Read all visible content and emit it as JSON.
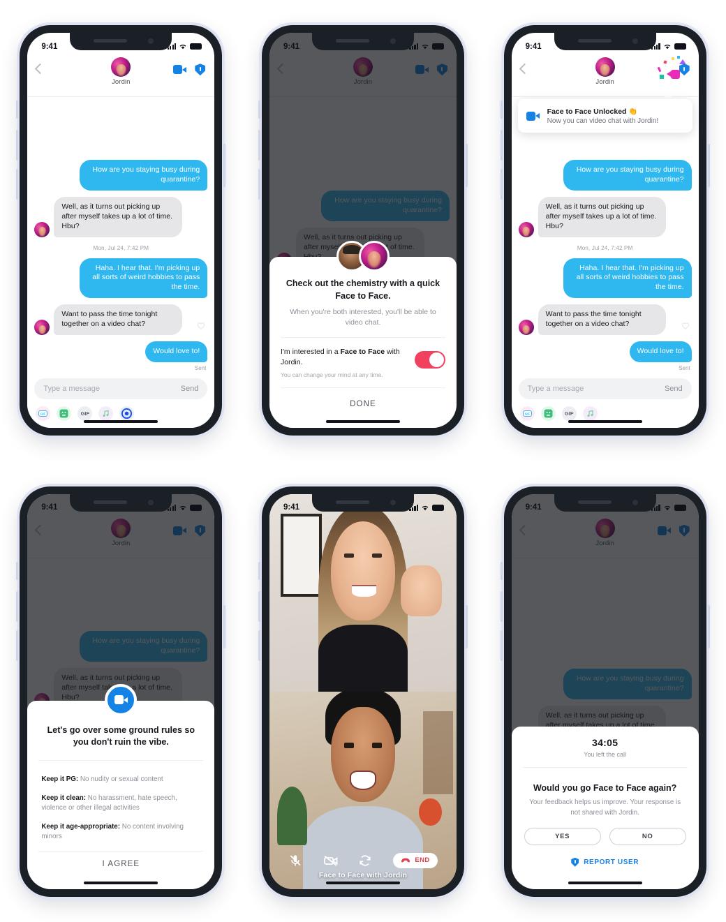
{
  "status_bar": {
    "time": "9:41",
    "signal_icon": "cellular-bars-icon",
    "wifi_icon": "wifi-icon",
    "battery_icon": "battery-icon"
  },
  "chat": {
    "contact_name": "Jordin",
    "back_icon": "back-chevron-icon",
    "video_icon": "video-camera-icon",
    "shield_icon": "shield-icon",
    "messages": [
      {
        "side": "out",
        "text": "How are you staying busy during quarantine?"
      },
      {
        "side": "in",
        "text": "Well, as it turns out picking up after myself takes up a lot of time. Hbu?"
      },
      {
        "side": "out",
        "text": "Haha. I hear that. I'm picking up all sorts of weird hobbies to pass the time."
      },
      {
        "side": "in",
        "text": "Want to pass the time tonight together on a video chat?"
      },
      {
        "side": "out",
        "text": "Would love to!"
      }
    ],
    "timestamp": "Mon, Jul 24, 7:42 PM",
    "sent_label": "Sent",
    "composer": {
      "placeholder": "Type a message",
      "send_label": "Send"
    },
    "tray": [
      {
        "name": "gif-sticker-icon",
        "label": "GIF"
      },
      {
        "name": "sticker-icon",
        "label": ""
      },
      {
        "name": "gif-icon",
        "label": "GIF"
      },
      {
        "name": "music-icon",
        "label": ""
      },
      {
        "name": "spotify-icon",
        "label": ""
      }
    ]
  },
  "toast": {
    "icon": "video-camera-icon",
    "title": "Face to Face Unlocked 👏",
    "subtitle": "Now you can video chat with Jordin!"
  },
  "interest_sheet": {
    "title": "Check out the chemistry with a quick Face to Face.",
    "subtitle": "When you're both interested, you'll be able to video chat.",
    "toggle_label_pre": "I'm interested in a ",
    "toggle_label_bold": "Face to Face",
    "toggle_label_post": " with Jordin.",
    "toggle_note": "You can change your mind at any time.",
    "toggle_state": "on",
    "toggle_color": "#f2405f",
    "cta": "DONE"
  },
  "rules_sheet": {
    "badge_icon": "video-camera-icon",
    "title": "Let's go over some ground rules so you don't ruin the vibe.",
    "rules": [
      {
        "bold": "Keep it PG:",
        "text": " No nudity or sexual content"
      },
      {
        "bold": "Keep it clean:",
        "text": " No harassment, hate speech, violence or other illegal activities"
      },
      {
        "bold": "Keep it age-appropriate:",
        "text": " No content involving minors"
      }
    ],
    "cta": "I AGREE"
  },
  "call_screen": {
    "mute_icon": "microphone-off-icon",
    "camera_off_icon": "video-off-icon",
    "flip_icon": "camera-flip-icon",
    "end_label": "END",
    "end_icon": "phone-hangup-icon",
    "end_color": "#e23b4e",
    "title": "Face to Face with Jordin"
  },
  "feedback_sheet": {
    "duration": "34:05",
    "status": "You left the call",
    "question": "Would you go Face to Face again?",
    "description": "Your feedback helps us improve. Your response is not shared with Jordin.",
    "yes_label": "YES",
    "no_label": "NO",
    "report_label": "REPORT USER",
    "report_icon": "shield-icon",
    "link_color": "#1583e5"
  },
  "theme": {
    "bubble_out": "#2fb8f0",
    "bubble_in": "#e6e6e8",
    "accent_blue": "#1583e5",
    "accent_magenta": "#e82bb8"
  }
}
